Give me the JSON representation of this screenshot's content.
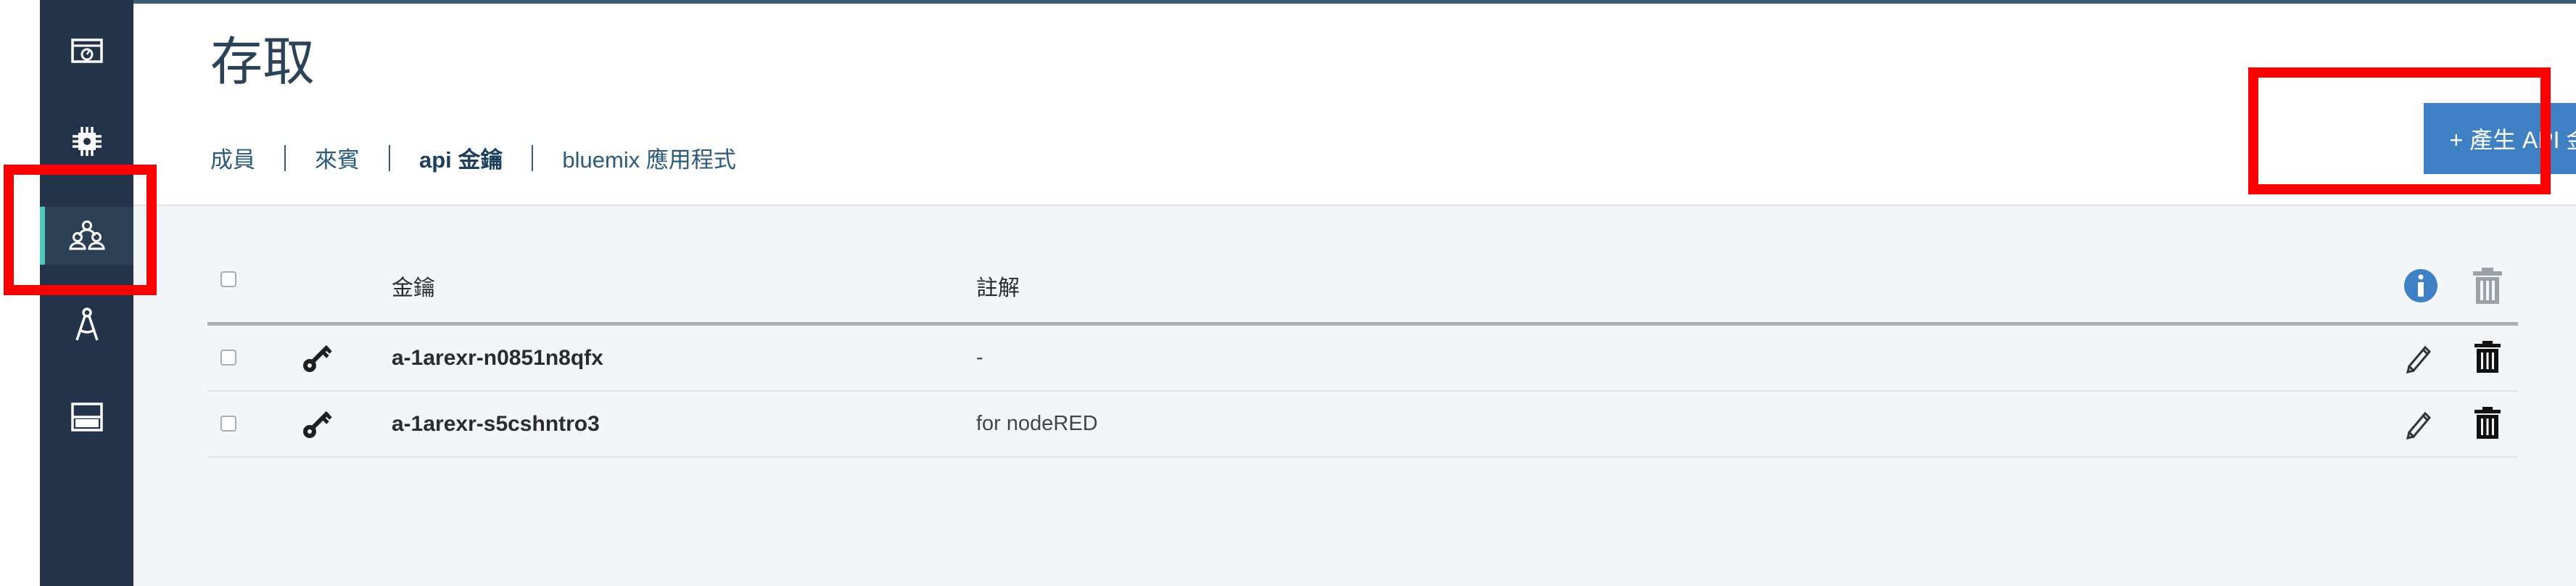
{
  "colors": {
    "sidebar": "#22334a",
    "accent": "#4ec9c0",
    "primary_button": "#3f7fc4",
    "highlight": "#ff0000"
  },
  "sidebar": {
    "items": [
      {
        "icon": "dashboard-icon"
      },
      {
        "icon": "chip-icon"
      },
      {
        "icon": "users-icon",
        "active": true
      },
      {
        "icon": "compass-icon"
      },
      {
        "icon": "storage-icon"
      }
    ]
  },
  "header": {
    "title": "存取",
    "tabs": [
      {
        "label": "成員"
      },
      {
        "label": "來賓"
      },
      {
        "label": "api 金鑰",
        "active": true
      },
      {
        "label": "bluemix 應用程式"
      }
    ],
    "create_button": "+ 產生 API 金鑰"
  },
  "table": {
    "columns": {
      "key": "金鑰",
      "note": "註解"
    },
    "rows": [
      {
        "key": "a-1arexr-n0851n8qfx",
        "note": "-"
      },
      {
        "key": "a-1arexr-s5cshntro3",
        "note": "for nodeRED"
      }
    ]
  }
}
